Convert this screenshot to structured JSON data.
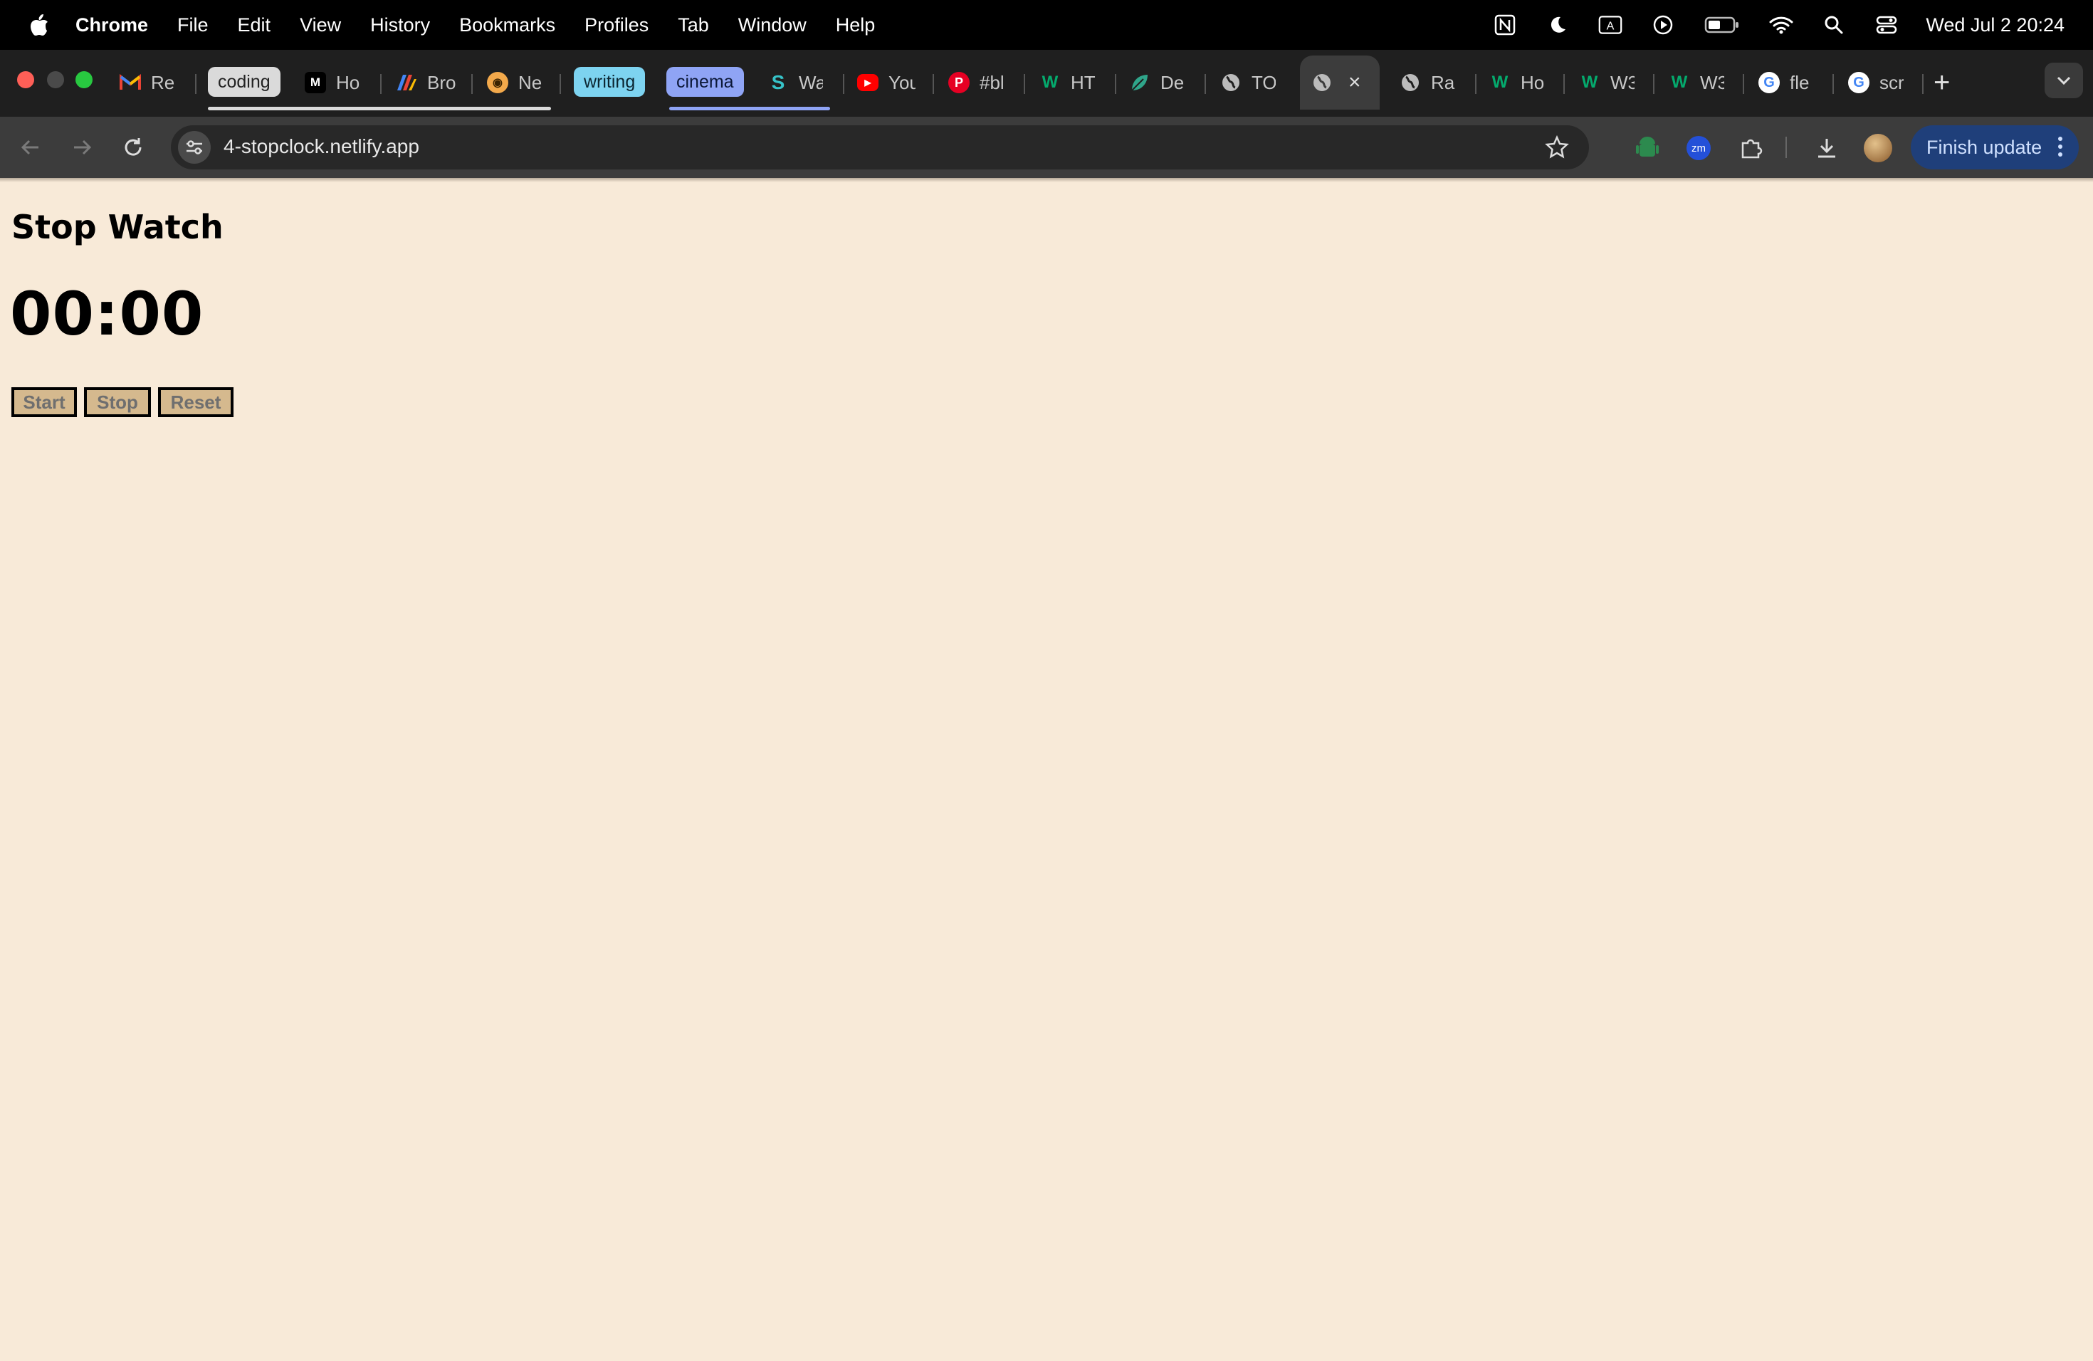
{
  "menubar": {
    "app_name": "Chrome",
    "items": [
      "File",
      "Edit",
      "View",
      "History",
      "Bookmarks",
      "Profiles",
      "Tab",
      "Window",
      "Help"
    ],
    "clock": "Wed Jul 2  20:24"
  },
  "tabs": {
    "groups": [
      {
        "label": "coding",
        "color": "#dadada"
      },
      {
        "label": "writing",
        "color": "#7dd3f0"
      },
      {
        "label": "cinema",
        "color": "#8fa4f5"
      }
    ],
    "items": [
      {
        "title": "Re",
        "favicon": "gmail-icon"
      },
      {
        "title": "Ho",
        "favicon": "medium-icon"
      },
      {
        "title": "Bro",
        "favicon": "multicolor-icon"
      },
      {
        "title": "Ne",
        "favicon": "tiger-icon"
      },
      {
        "title": "Wa",
        "favicon": "s-logo-icon"
      },
      {
        "title": "You",
        "favicon": "youtube-icon"
      },
      {
        "title": "#bl",
        "favicon": "pinterest-icon"
      },
      {
        "title": "HT",
        "favicon": "w3-icon"
      },
      {
        "title": "De",
        "favicon": "green-leaf-icon"
      },
      {
        "title": "TO",
        "favicon": "globe-icon"
      },
      {
        "title": "",
        "favicon": "globe-icon"
      },
      {
        "title": "Ra",
        "favicon": "globe-icon"
      },
      {
        "title": "Ho",
        "favicon": "w3-icon"
      },
      {
        "title": "W3",
        "favicon": "w3-icon"
      },
      {
        "title": "W3",
        "favicon": "w3-icon"
      },
      {
        "title": "fle",
        "favicon": "google-icon"
      },
      {
        "title": "scr",
        "favicon": "google-icon"
      }
    ]
  },
  "toolbar": {
    "url": "4-stopclock.netlify.app",
    "finish_update": "Finish update"
  },
  "page": {
    "title": "Stop Watch",
    "timer": "00:00",
    "buttons": {
      "start": "Start",
      "stop": "Stop",
      "reset": "Reset"
    }
  },
  "colors": {
    "page_bg": "#f8ead8",
    "button_bg": "#d5b98e"
  }
}
